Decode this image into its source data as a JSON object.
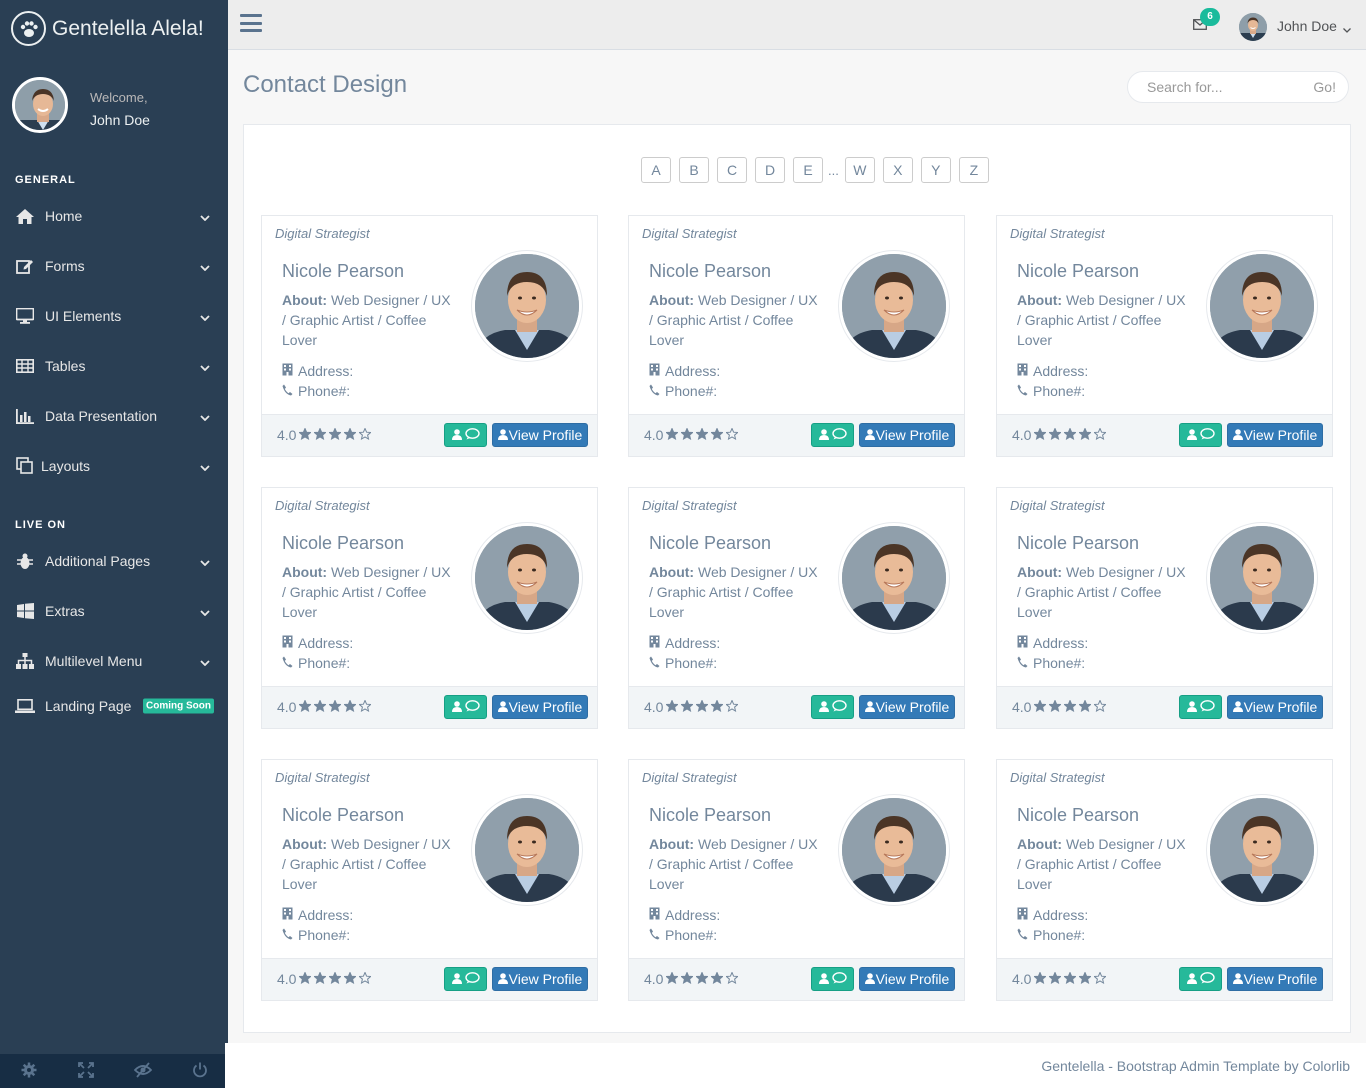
{
  "brand": {
    "title": "Gentelella Alela!"
  },
  "profile": {
    "welcome": "Welcome,",
    "name": "John Doe"
  },
  "sidebar": {
    "general_title": "GENERAL",
    "general": [
      {
        "label": "Home",
        "icon": "home-icon"
      },
      {
        "label": "Forms",
        "icon": "edit-icon"
      },
      {
        "label": "UI Elements",
        "icon": "desktop-icon"
      },
      {
        "label": "Tables",
        "icon": "table-icon"
      },
      {
        "label": "Data Presentation",
        "icon": "bar-chart-icon"
      },
      {
        "label": "Layouts",
        "icon": "clone-icon"
      }
    ],
    "live_title": "LIVE ON",
    "live": [
      {
        "label": "Additional Pages",
        "icon": "bug-icon"
      },
      {
        "label": "Extras",
        "icon": "windows-icon"
      },
      {
        "label": "Multilevel Menu",
        "icon": "sitemap-icon"
      },
      {
        "label": "Landing Page",
        "icon": "laptop-icon",
        "badge": "Coming Soon"
      }
    ],
    "footer_icons": [
      "settings-icon",
      "fullscreen-icon",
      "lock-icon",
      "logout-icon"
    ]
  },
  "topnav": {
    "mail_count": "6",
    "user_name": "John Doe"
  },
  "page": {
    "title": "Contact Design"
  },
  "search": {
    "placeholder": "Search for...",
    "button": "Go!"
  },
  "alphabet": {
    "before": [
      "A",
      "B",
      "C",
      "D",
      "E"
    ],
    "ellipsis": "...",
    "after": [
      "W",
      "X",
      "Y",
      "Z"
    ]
  },
  "card": {
    "role": "Digital Strategist",
    "name": "Nicole Pearson",
    "about_label": "About:",
    "about_text": "Web Designer / UX / Graphic Artist / Coffee Lover",
    "address_label": "Address:",
    "phone_label": "Phone#:",
    "rating_value": "4.0",
    "stars_filled": 4,
    "stars_total": 5,
    "view_label": "View Profile"
  },
  "cards_count": 9,
  "footer": {
    "text": "Gentelella - Bootstrap Admin Template by Colorlib"
  },
  "colors": {
    "sidebar": "#2A3F54",
    "accent": "#26B99A",
    "primary": "#337AB7"
  }
}
